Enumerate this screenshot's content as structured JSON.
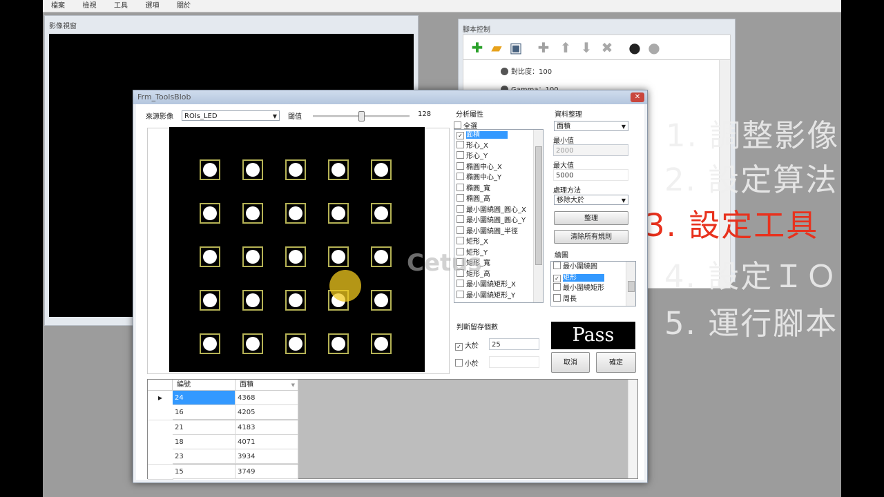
{
  "menu": [
    "檔案",
    "檢視",
    "工具",
    "選項",
    "關於"
  ],
  "viewer": {
    "title": "影像視窗"
  },
  "script_panel": {
    "title": "腳本控制",
    "toolbar_icons": [
      "add-icon",
      "open-folder-icon",
      "save-icon",
      "plus-icon",
      "up-arrow-icon",
      "down-arrow-icon",
      "delete-icon",
      "play-icon",
      "stop-icon"
    ],
    "items": [
      "對比度：100",
      "Gamma：100"
    ]
  },
  "steps": [
    "1. 調整影像",
    "2. 設定算法",
    "3. 設定工具",
    "4. 設定ＩＯ",
    "5. 運行腳本"
  ],
  "step_active_color": "#e8321e",
  "dialog": {
    "title": "Frm_ToolsBlob",
    "source_label": "來源影像",
    "source_value": "ROIs_LED",
    "threshold_label": "閾值",
    "threshold_value": "128",
    "threshold_fraction": 0.5,
    "attr": {
      "title": "分析屬性",
      "select_all": "全選",
      "items": [
        "面積",
        "形心_X",
        "形心_Y",
        "橢圓中心_X",
        "橢圓中心_Y",
        "橢圓_寬",
        "橢圓_高",
        "最小圍繞圓_圓心_X",
        "最小圍繞圓_圓心_Y",
        "最小圍繞圓_半徑",
        "矩形_X",
        "矩形_Y",
        "矩形_寬",
        "矩形_高",
        "最小圍繞矩形_X",
        "最小圍繞矩形_Y"
      ],
      "checked_index": 0
    },
    "data_org": {
      "title": "資料整理",
      "field": "面積",
      "min_label": "最小值",
      "min_value": "2000",
      "max_label": "最大值",
      "max_value": "5000",
      "method_label": "處理方法",
      "method_value": "移除大於",
      "organize_btn": "整理",
      "clear_btn": "清除所有規則"
    },
    "draw": {
      "title": "繪圖",
      "items": [
        "最小圍繞圓",
        "矩形",
        "最小圍繞矩形",
        "周長"
      ],
      "checked_index": 1
    },
    "judge": {
      "title": "判斷留存個數",
      "gt_label": "大於",
      "gt_value": "25",
      "gt_checked": true,
      "lt_label": "小於",
      "lt_value": "",
      "lt_checked": false
    },
    "result": "Pass",
    "cancel_btn": "取消",
    "ok_btn": "確定",
    "table": {
      "headers": [
        "編號",
        "面積"
      ],
      "rows": [
        [
          "24",
          "4368"
        ],
        [
          "16",
          "4205"
        ],
        [
          "21",
          "4183"
        ],
        [
          "18",
          "4071"
        ],
        [
          "23",
          "3934"
        ],
        [
          "15",
          "3749"
        ]
      ]
    }
  },
  "watermark": "Cetus"
}
